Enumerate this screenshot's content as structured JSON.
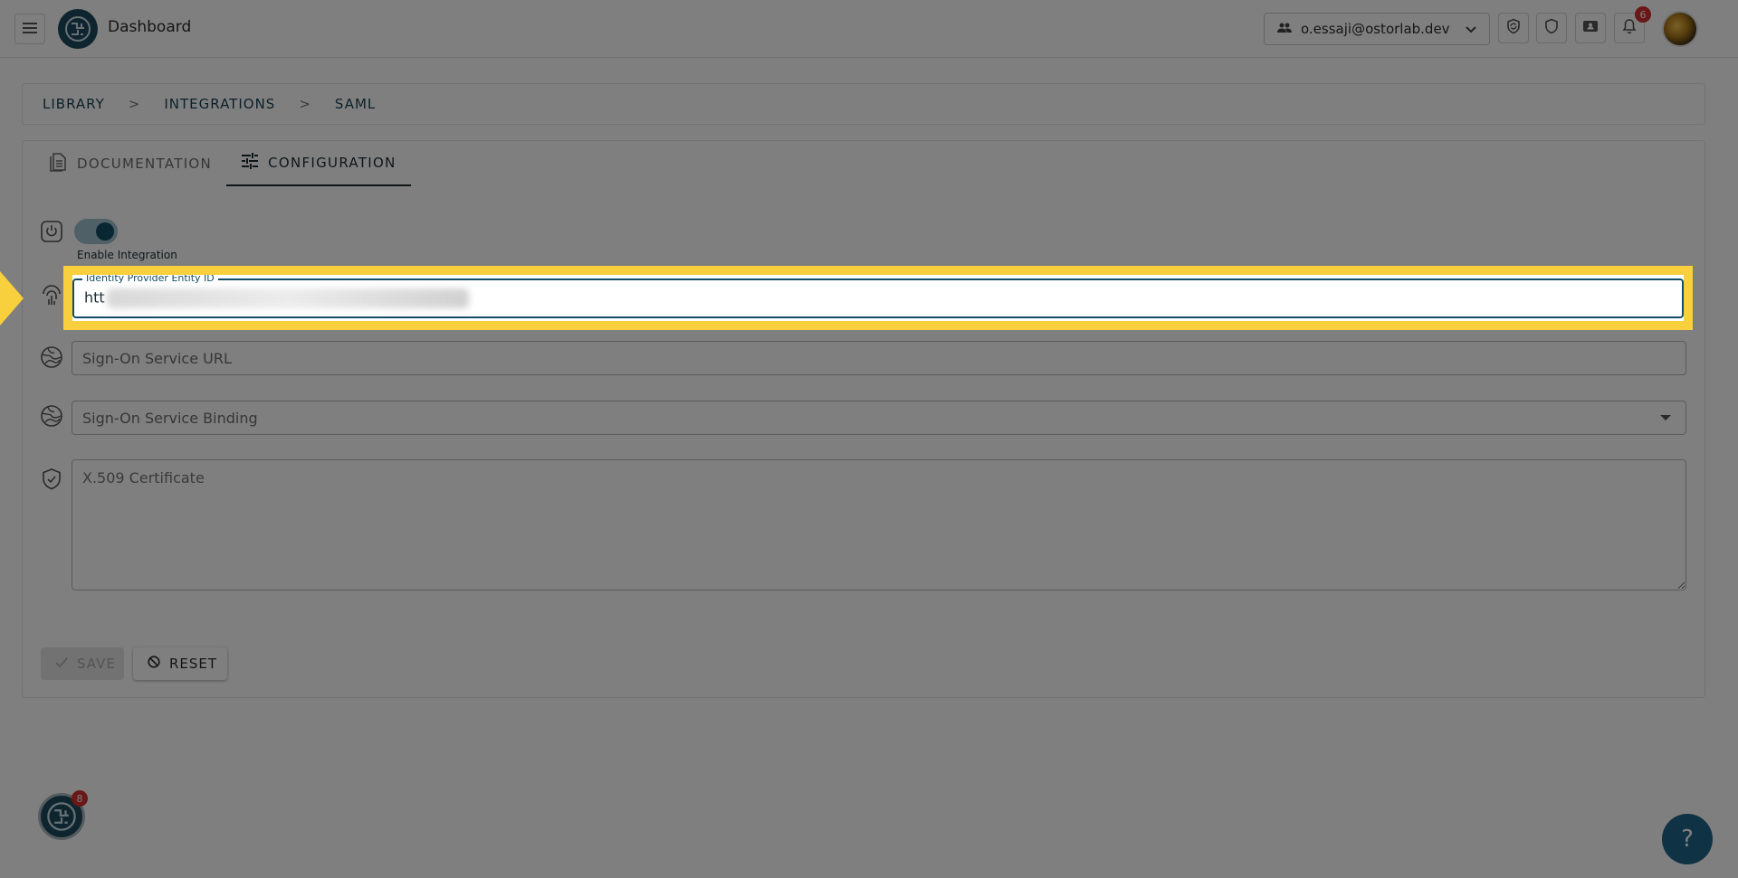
{
  "header": {
    "title": "Dashboard",
    "org_email": "o.essaji@ostorlab.dev",
    "notification_count": "6"
  },
  "breadcrumb": [
    "LIBRARY",
    "INTEGRATIONS",
    "SAML"
  ],
  "breadcrumb_separator": ">",
  "tabs": [
    {
      "label": "DOCUMENTATION",
      "active": false
    },
    {
      "label": "CONFIGURATION",
      "active": true
    }
  ],
  "form": {
    "enable_label": "Enable Integration",
    "enabled": true,
    "entity_id": {
      "label": "Identity Provider Entity ID",
      "value": "htt"
    },
    "sign_on_url": {
      "placeholder": "Sign-On Service URL"
    },
    "sign_on_binding": {
      "placeholder": "Sign-On Service Binding"
    },
    "certificate": {
      "placeholder": "X.509 Certificate"
    }
  },
  "buttons": {
    "save": "SAVE",
    "reset": "RESET"
  },
  "floating": {
    "logo_badge": "8",
    "help": "?"
  },
  "colors": {
    "primary": "#134c67",
    "highlight": "#f8cf3c",
    "badge": "#d32f2f"
  }
}
